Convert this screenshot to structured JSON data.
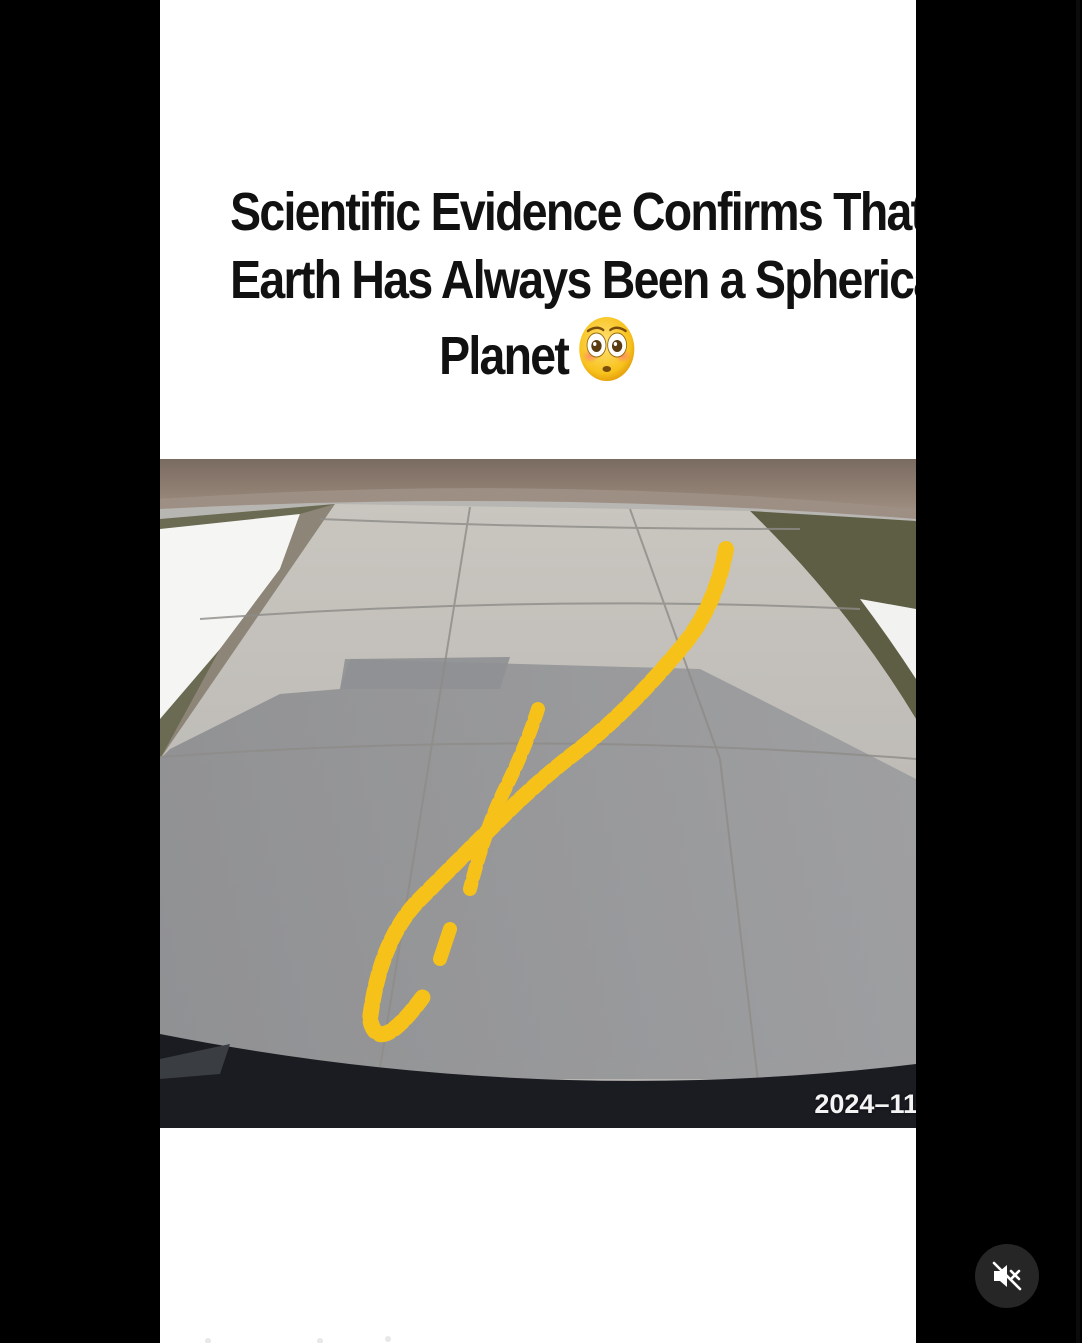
{
  "post": {
    "caption_lines": [
      "Scientific Evidence Confirms That",
      "Earth Has Always Been a Spherical",
      "Planet"
    ],
    "caption_emoji": "flushed-face-emoji"
  },
  "video": {
    "timestamp": "2024–11",
    "scene": "driveway-camera-footage",
    "trace_color": "#f6c21a"
  },
  "controls": {
    "mute_icon": "speaker-muted-icon",
    "mute_button_color": "#262626"
  }
}
